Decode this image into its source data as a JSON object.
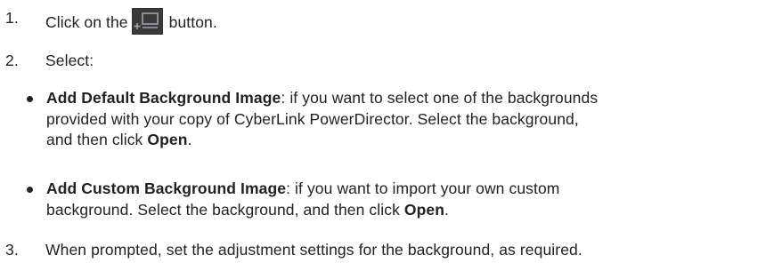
{
  "steps": [
    {
      "number": "1.",
      "before": "Click on the",
      "icon": "add-background-button-icon",
      "after": "button."
    },
    {
      "number": "2.",
      "text": "Select:"
    },
    {
      "number": "3.",
      "text": "When prompted, set the adjustment settings for the background, as required."
    }
  ],
  "bullets": [
    {
      "title": "Add Default Background Image",
      "line1_rest": ": if you want to select one of the backgrounds",
      "line2": "provided with your copy of CyberLink PowerDirector. Select the background,",
      "line3_before": "and then click ",
      "line3_bold": "Open",
      "line3_after": "."
    },
    {
      "title": "Add Custom Background Image",
      "line1_rest": ": if you want to import your own custom",
      "line2_before": "background. Select the background, and then click ",
      "line2_bold": "Open",
      "line2_after": "."
    }
  ],
  "colors": {
    "text": "#222222",
    "icon_bg": "#3a3a3a",
    "icon_fg": "#9aa3ad"
  }
}
